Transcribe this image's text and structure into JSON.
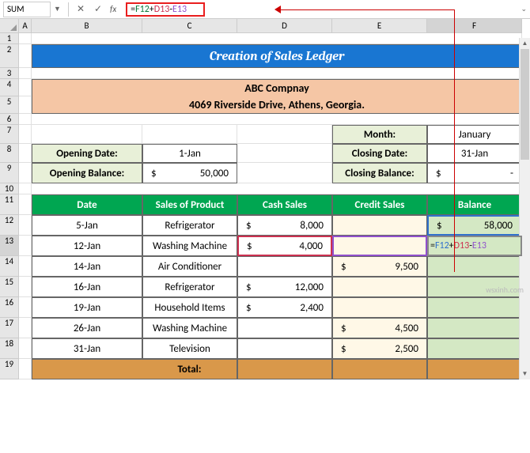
{
  "name_box": "SUM",
  "formula_text": "=F12+D13-E13",
  "formula_parts": {
    "eq": "=",
    "r1": "F12",
    "op1": "+",
    "r2": "D13",
    "op2": "-",
    "r3": "E13"
  },
  "columns": [
    "A",
    "B",
    "C",
    "D",
    "E",
    "F"
  ],
  "title": "Creation of Sales Ledger",
  "company_name": "ABC Compnay",
  "company_addr": "4069 Riverside Drive, Athens, Georgia.",
  "labels": {
    "month": "Month:",
    "opening_date": "Opening Date:",
    "closing_date": "Closing Date:",
    "opening_balance": "Opening Balance:",
    "closing_balance": "Closing Balance:"
  },
  "values": {
    "month": "January",
    "opening_date": "1-Jan",
    "closing_date": "31-Jan",
    "opening_balance": "50,000",
    "closing_balance": "-"
  },
  "headers": {
    "date": "Date",
    "product": "Sales of Product",
    "cash": "Cash Sales",
    "credit": "Credit Sales",
    "balance": "Balance"
  },
  "rows": [
    {
      "date": "5-Jan",
      "product": "Refrigerator",
      "cash": "8,000",
      "credit": "",
      "balance": "58,000"
    },
    {
      "date": "12-Jan",
      "product": "Washing Machine",
      "cash": "4,000",
      "credit": "",
      "balance_formula": true
    },
    {
      "date": "14-Jan",
      "product": "Air Conditioner",
      "cash": "",
      "credit": "9,500",
      "balance": ""
    },
    {
      "date": "16-Jan",
      "product": "Refrigerator",
      "cash": "12,000",
      "credit": "",
      "balance": ""
    },
    {
      "date": "19-Jan",
      "product": "Household Items",
      "cash": "2,400",
      "credit": "",
      "balance": ""
    },
    {
      "date": "26-Jan",
      "product": "Washing Machine",
      "cash": "",
      "credit": "4,500",
      "balance": ""
    },
    {
      "date": "31-Jan",
      "product": "Television",
      "cash": "",
      "credit": "2,500",
      "balance": ""
    }
  ],
  "total_label": "Total:",
  "watermark": "wsxinh.com",
  "row_heights": {
    "r1": 14,
    "r2": 30,
    "r3": 14,
    "r4": 22,
    "r5": 22,
    "r6": 14,
    "r7": 24,
    "r8": 24,
    "r9": 26,
    "r10": 14,
    "r11": 26,
    "r12": 26,
    "r13": 26,
    "r14": 26,
    "r15": 26,
    "r16": 26,
    "r17": 26,
    "r18": 26,
    "r19": 26
  },
  "currency": "$",
  "chart_data": {
    "type": "table",
    "title": "Creation of Sales Ledger",
    "company": "ABC Compnay",
    "address": "4069 Riverside Drive, Athens, Georgia.",
    "month": "January",
    "opening_date": "1-Jan",
    "closing_date": "31-Jan",
    "opening_balance": 50000,
    "closing_balance": null,
    "columns": [
      "Date",
      "Sales of Product",
      "Cash Sales",
      "Credit Sales",
      "Balance"
    ],
    "records": [
      {
        "date": "5-Jan",
        "product": "Refrigerator",
        "cash_sales": 8000,
        "credit_sales": null,
        "balance": 58000
      },
      {
        "date": "12-Jan",
        "product": "Washing Machine",
        "cash_sales": 4000,
        "credit_sales": null,
        "balance": null
      },
      {
        "date": "14-Jan",
        "product": "Air Conditioner",
        "cash_sales": null,
        "credit_sales": 9500,
        "balance": null
      },
      {
        "date": "16-Jan",
        "product": "Refrigerator",
        "cash_sales": 12000,
        "credit_sales": null,
        "balance": null
      },
      {
        "date": "19-Jan",
        "product": "Household Items",
        "cash_sales": 2400,
        "credit_sales": null,
        "balance": null
      },
      {
        "date": "26-Jan",
        "product": "Washing Machine",
        "cash_sales": null,
        "credit_sales": 4500,
        "balance": null
      },
      {
        "date": "31-Jan",
        "product": "Television",
        "cash_sales": null,
        "credit_sales": 2500,
        "balance": null
      }
    ],
    "active_formula": "=F12+D13-E13"
  }
}
